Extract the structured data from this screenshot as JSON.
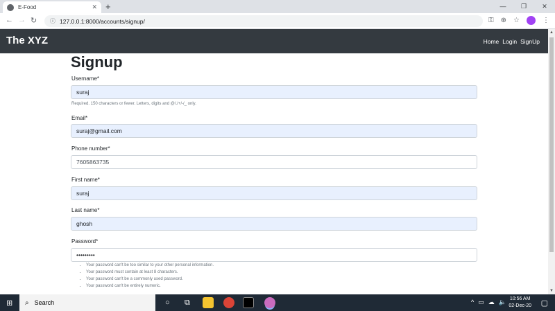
{
  "browser": {
    "tab_title": "E-Food",
    "tab_close": "✕",
    "new_tab": "+",
    "url": "127.0.0.1:8000/accounts/signup/",
    "win_min": "—",
    "win_restore": "❐",
    "win_close": "✕"
  },
  "navbar": {
    "brand": "The XYZ",
    "links": [
      "Home",
      "Login",
      "SignUp"
    ]
  },
  "form": {
    "heading": "Signup",
    "username": {
      "label": "Username*",
      "value": "suraj",
      "help": "Required. 150 characters or fewer. Letters, digits and @/./+/-/_ only."
    },
    "email": {
      "label": "Email*",
      "value": "suraj@gmail.com"
    },
    "phone": {
      "label": "Phone number*",
      "value": "7605863735"
    },
    "first_name": {
      "label": "First name*",
      "value": "suraj"
    },
    "last_name": {
      "label": "Last name*",
      "value": "ghosh"
    },
    "password": {
      "label": "Password*",
      "value": "•••••••••",
      "help": [
        "Your password can't be too similar to your other personal information.",
        "Your password must contain at least 8 characters.",
        "Your password can't be a commonly used password.",
        "Your password can't be entirely numeric."
      ]
    }
  },
  "taskbar": {
    "search_label": "Search",
    "time": "10:56 AM",
    "date": "02-Dec-20"
  },
  "colors": {
    "navbar": "#343a40",
    "autofill": "#e8f0fe",
    "taskbar": "#1f2a36"
  }
}
